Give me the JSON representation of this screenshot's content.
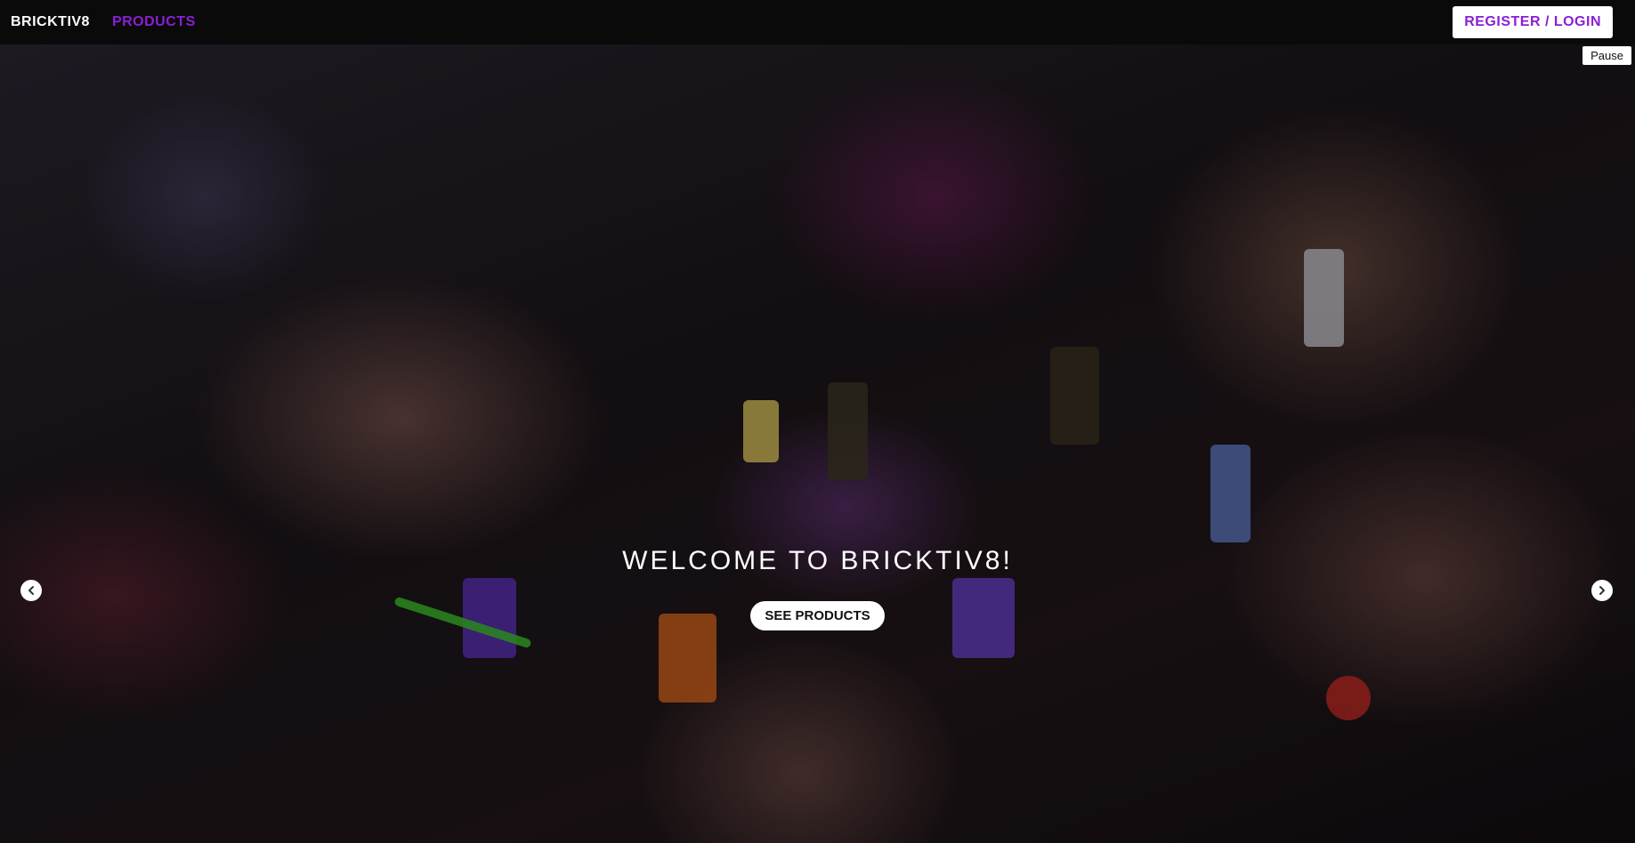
{
  "navbar": {
    "brand": "BRICKTIV8",
    "products_link": "PRODUCTS",
    "register_login": "REGISTER / LOGIN",
    "accent_color": "#8a1fd6"
  },
  "carousel": {
    "pause_label": "Pause",
    "prev_icon": "chevron-left-icon",
    "next_icon": "chevron-right-icon"
  },
  "hero": {
    "image_icon": "hero-photo-hands-holding-minifigures",
    "title": "WELCOME TO BRICKTIV8!",
    "cta_label": "SEE PRODUCTS"
  }
}
